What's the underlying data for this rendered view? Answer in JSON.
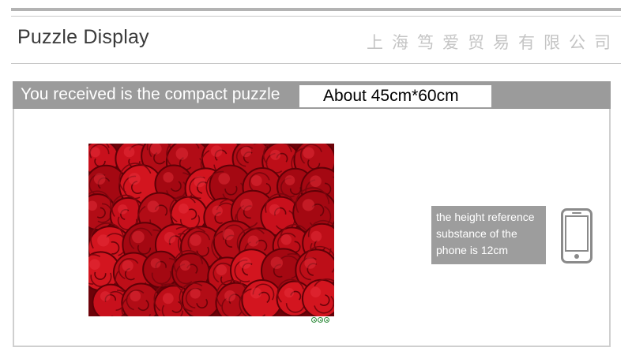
{
  "header": {
    "title": "Puzzle Display",
    "company": "上海笃爱贸易有限公司"
  },
  "panel": {
    "title": "You received is the compact puzzle",
    "size_text": "About  45cm*60cm"
  },
  "product_image": {
    "subject": "red roses"
  },
  "reference": {
    "text": "the height reference substance of the phone is 12cm",
    "icon": "smartphone-icon"
  },
  "colors": {
    "bar_gray": "#9b9b9b",
    "rose_red": "#c8101c",
    "logo_green": "#2e8b3a"
  }
}
